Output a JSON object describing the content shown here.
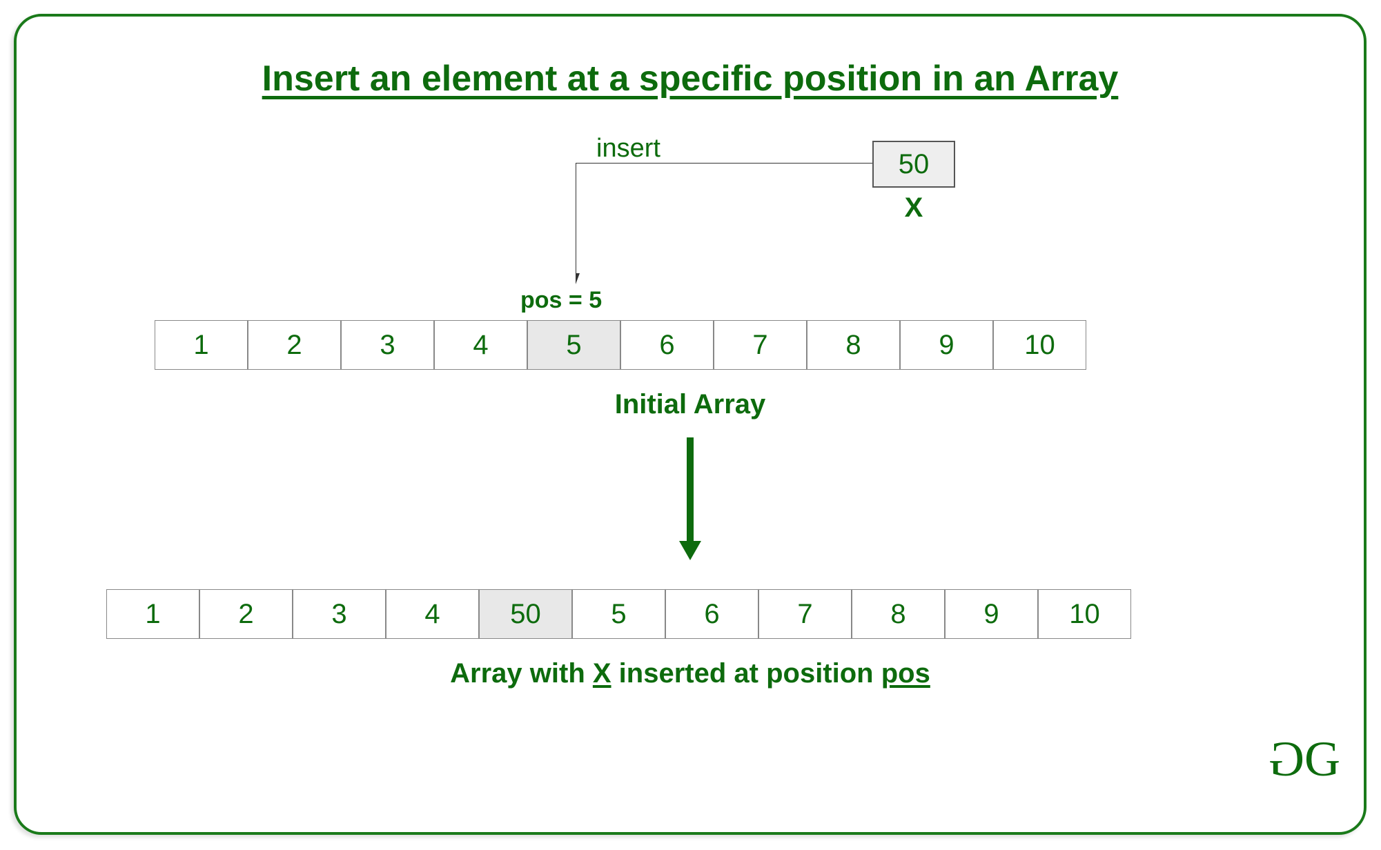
{
  "title": "Insert an element at a specific position in an Array",
  "insert": {
    "label": "insert",
    "value": "50",
    "var_name": "X"
  },
  "pos_label": "pos = 5",
  "initial_array": {
    "caption": "Initial Array",
    "values": [
      "1",
      "2",
      "3",
      "4",
      "5",
      "6",
      "7",
      "8",
      "9",
      "10"
    ],
    "highlight_index": 4
  },
  "result_array": {
    "caption_prefix": "Array with ",
    "caption_x": "X",
    "caption_mid": " inserted at position ",
    "caption_pos": "pos",
    "values": [
      "1",
      "2",
      "3",
      "4",
      "50",
      "5",
      "6",
      "7",
      "8",
      "9",
      "10"
    ],
    "highlight_index": 4
  },
  "logo": {
    "g1": "G",
    "g2": "G"
  },
  "colors": {
    "brand": "#0d6b0d"
  }
}
